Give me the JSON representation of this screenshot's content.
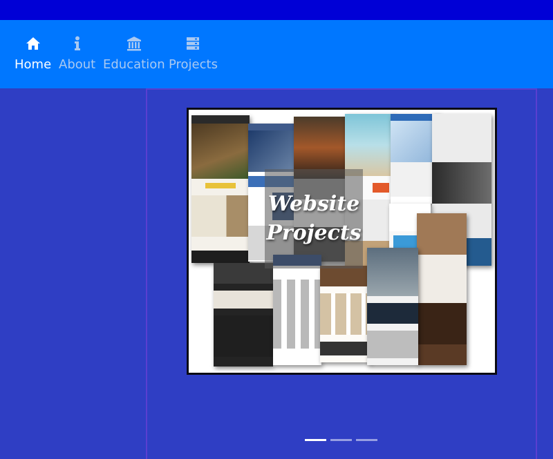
{
  "nav": {
    "items": [
      {
        "label": "Home",
        "icon": "home-icon",
        "active": true
      },
      {
        "label": "About",
        "icon": "info-icon",
        "active": false
      },
      {
        "label": "Education",
        "icon": "institution-icon",
        "active": false
      },
      {
        "label": "Projects",
        "icon": "server-icon",
        "active": false
      }
    ]
  },
  "carousel": {
    "slides": [
      {
        "caption_line1": "Website",
        "caption_line2": "Projects",
        "active": true
      }
    ],
    "indicator_count": 3,
    "active_indicator": 0
  },
  "colors": {
    "top_bar": "#0000d6",
    "navbar": "#0077ff",
    "page_bg": "#2f3ec4",
    "nav_inactive_text": "#a9c9f2",
    "nav_active_text": "#ffffff"
  }
}
